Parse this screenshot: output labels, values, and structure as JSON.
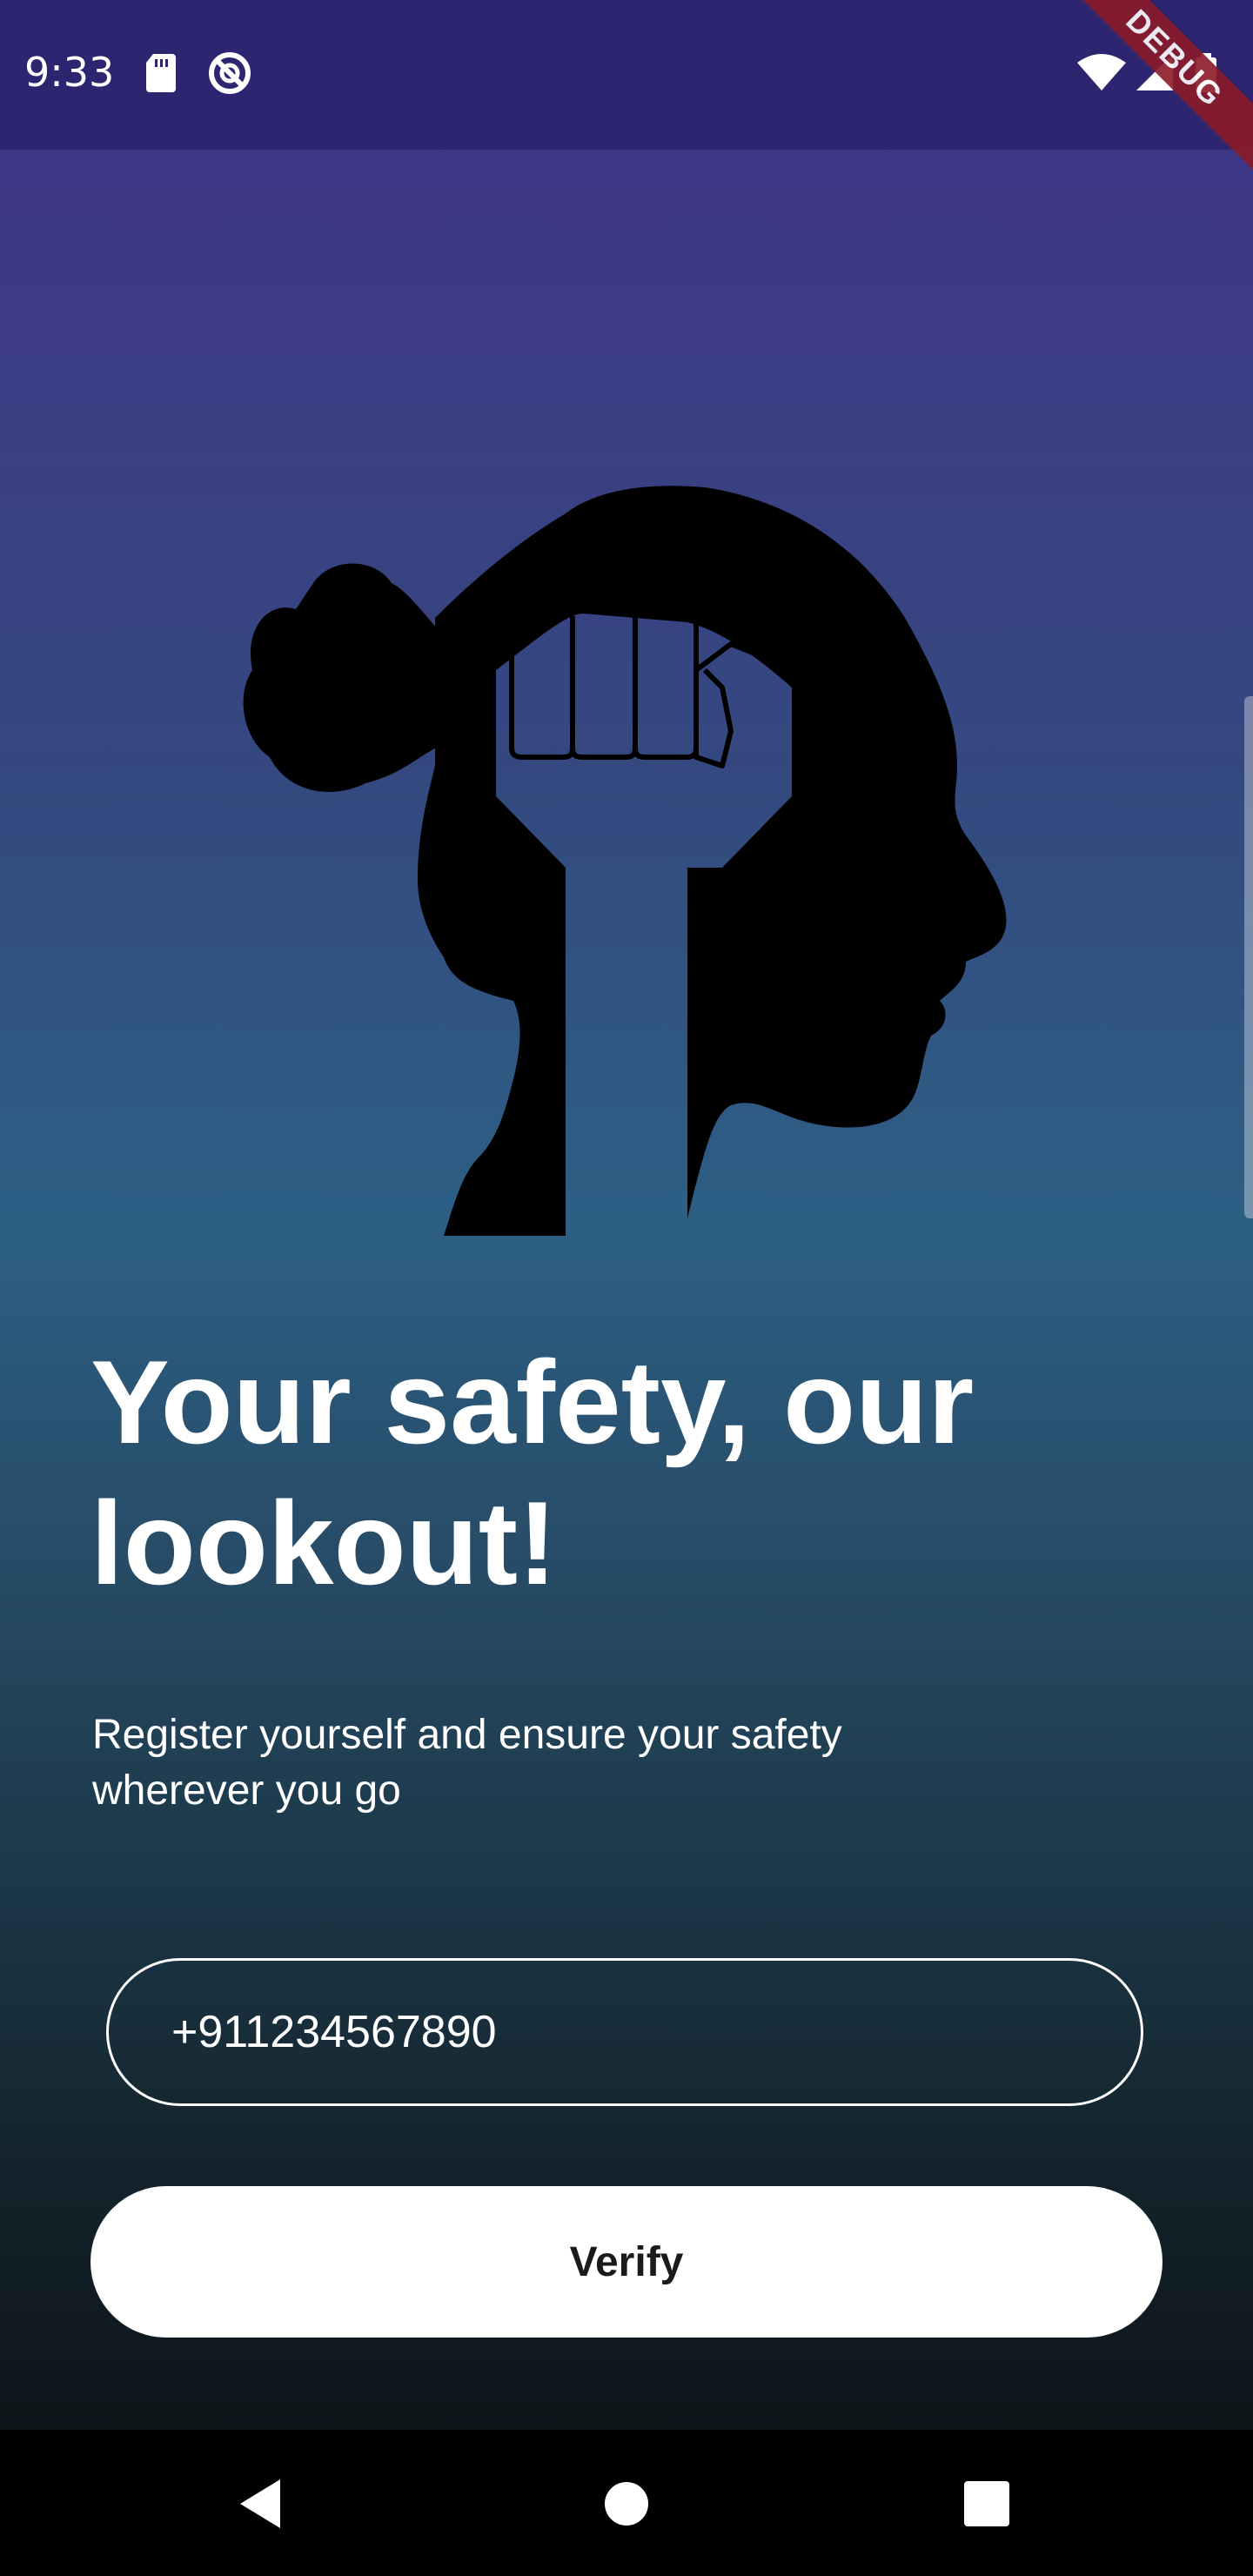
{
  "status_bar": {
    "time": "9:33",
    "left_icons": [
      "sd-card-icon",
      "do-not-disturb-icon"
    ],
    "right_icons": [
      "wifi-icon",
      "cell-signal-icon",
      "battery-icon"
    ],
    "debug_banner": "DEBUG",
    "debug_color": "#8a1a28"
  },
  "hero": {
    "icon": "woman-profile-fist-icon"
  },
  "headline": "Your safety, our lookout!",
  "subtitle": "Register yourself and ensure your safety wherever you go",
  "phone_input": {
    "value": "+911234567890",
    "placeholder": ""
  },
  "verify_button": {
    "label": "Verify"
  },
  "nav_bar": {
    "buttons": [
      "back-icon",
      "home-icon",
      "recents-icon"
    ]
  },
  "colors": {
    "status_bar": "#2e2570",
    "gradient_top": "#3f2f88",
    "gradient_mid": "#2d5f85",
    "gradient_bottom": "#0d1519",
    "button_bg": "#ffffff",
    "button_text": "#1a1a1a"
  }
}
